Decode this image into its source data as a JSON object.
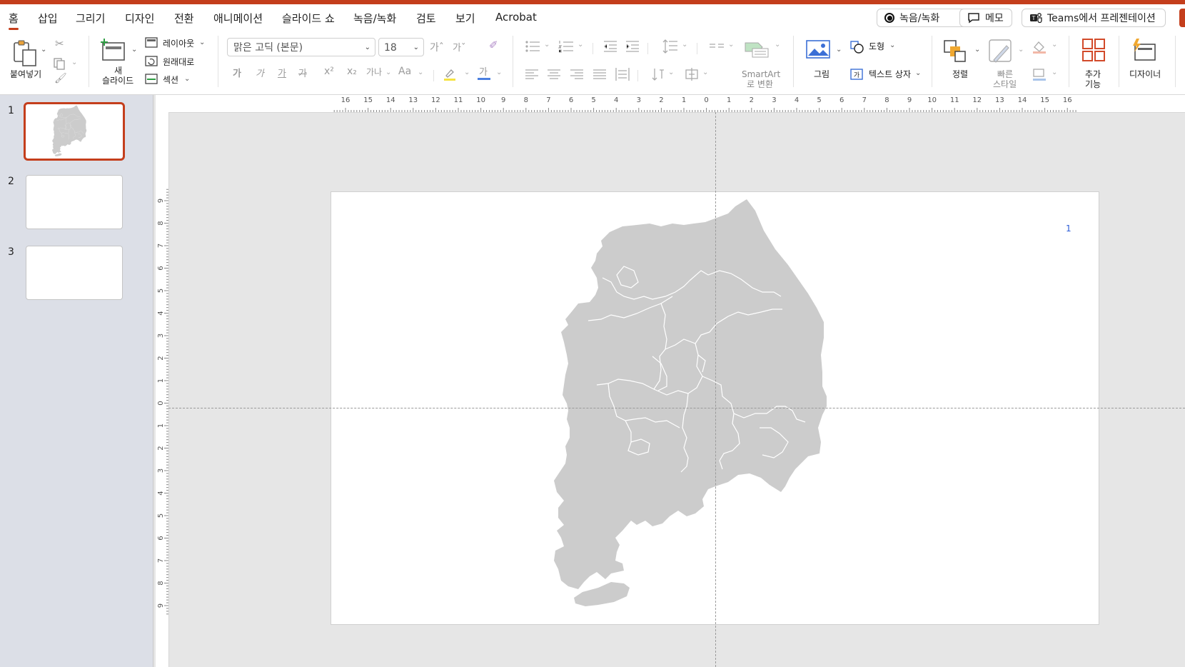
{
  "menu": {
    "tabs": [
      "홈",
      "삽입",
      "그리기",
      "디자인",
      "전환",
      "애니메이션",
      "슬라이드 쇼",
      "녹음/녹화",
      "검토",
      "보기",
      "Acrobat"
    ],
    "record_label": "녹음/녹화",
    "comment_label": "메모",
    "teams_label": "Teams에서 프레젠테이션"
  },
  "ribbon": {
    "paste": "붙여넣기",
    "new_slide_1": "새",
    "new_slide_2": "슬라이드",
    "layout": "레이아웃",
    "reset": "원래대로",
    "section": "섹션",
    "font_name": "맑은 고딕 (본문)",
    "font_size": "18",
    "font_grow": "가ˆ",
    "font_shrink": "가ˇ",
    "bold": "가",
    "italic": "가",
    "underline": "가",
    "strike": "가",
    "superscript": "x²",
    "subscript": "x₂",
    "spacing": "가나",
    "case": "Aa",
    "font_color_glyph": "가",
    "smartart_1": "SmartArt",
    "smartart_2": "로 변환",
    "picture": "그림",
    "shape": "도형",
    "textbox": "텍스트 상자",
    "arrange": "정렬",
    "quick_style_1": "빠른",
    "quick_style_2": "스타일",
    "addins_1": "추가",
    "addins_2": "기능",
    "designer": "디자이너"
  },
  "slides": {
    "numbers": [
      "1",
      "2",
      "3"
    ]
  },
  "ruler": {
    "h_labels": [
      "16",
      "15",
      "14",
      "13",
      "12",
      "11",
      "10",
      "9",
      "8",
      "7",
      "6",
      "5",
      "4",
      "3",
      "2",
      "1",
      "0",
      "1",
      "2",
      "3",
      "4",
      "5",
      "6",
      "7",
      "8",
      "9",
      "10",
      "11",
      "12",
      "13",
      "14",
      "15",
      "16"
    ],
    "v_labels": [
      "9",
      "8",
      "7",
      "6",
      "5",
      "4",
      "3",
      "2",
      "1",
      "0",
      "1",
      "2",
      "3",
      "4",
      "5",
      "6",
      "7",
      "8",
      "9"
    ]
  },
  "slide": {
    "page_number": "1"
  },
  "colors": {
    "accent": "#c43e1c",
    "map_fill": "#cccccc",
    "page_number": "#2a5bd7"
  }
}
